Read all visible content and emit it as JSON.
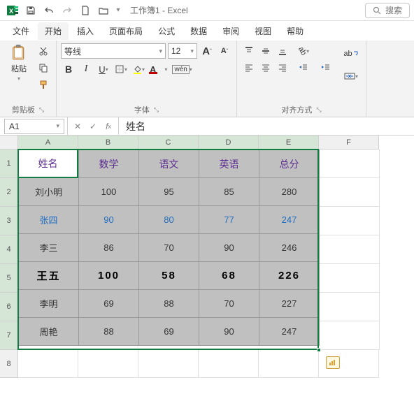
{
  "titlebar": {
    "doc_title": "工作簿1 - Excel",
    "search_placeholder": "搜索"
  },
  "tabs": [
    "文件",
    "开始",
    "插入",
    "页面布局",
    "公式",
    "数据",
    "审阅",
    "视图",
    "帮助"
  ],
  "active_tab": 1,
  "ribbon": {
    "clipboard": {
      "paste_label": "粘贴",
      "group_label": "剪贴板"
    },
    "font": {
      "name": "等线",
      "size": "12",
      "group_label": "字体"
    },
    "alignment": {
      "group_label": "对齐方式"
    }
  },
  "namebox": "A1",
  "formula": "姓名",
  "columns": [
    "A",
    "B",
    "C",
    "D",
    "E",
    "F"
  ],
  "row_numbers": [
    "1",
    "2",
    "3",
    "4",
    "5",
    "6",
    "7",
    "8"
  ],
  "chart_data": {
    "type": "table",
    "headers": [
      "姓名",
      "数学",
      "语文",
      "英语",
      "总分"
    ],
    "rows": [
      [
        "刘小明",
        "100",
        "95",
        "85",
        "280"
      ],
      [
        "张四",
        "90",
        "80",
        "77",
        "247"
      ],
      [
        "李三",
        "86",
        "70",
        "90",
        "246"
      ],
      [
        "王五",
        "100",
        "58",
        "68",
        "226"
      ],
      [
        "李明",
        "69",
        "88",
        "70",
        "227"
      ],
      [
        "周艳",
        "88",
        "69",
        "90",
        "247"
      ]
    ]
  },
  "colors": {
    "accent": "#107c41",
    "header_text": "#5c2d91",
    "link_row": "#1f6dbf"
  }
}
